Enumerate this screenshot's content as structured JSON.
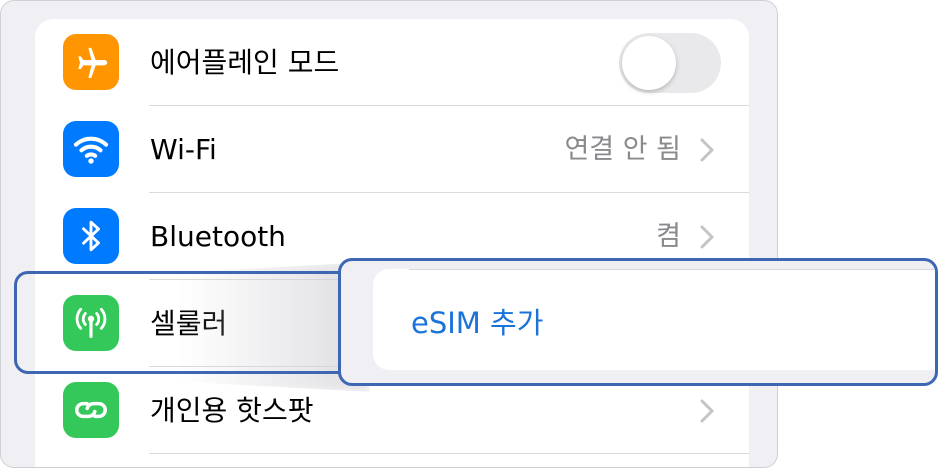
{
  "settings": {
    "rows": [
      {
        "label": "에어플레인 모드",
        "icon": "airplane-icon",
        "icon_color": "#ff9500",
        "control": "toggle",
        "toggle_on": false
      },
      {
        "label": "Wi-Fi",
        "icon": "wifi-icon",
        "icon_color": "#007aff",
        "value": "연결 안 됨",
        "control": "chevron"
      },
      {
        "label": "Bluetooth",
        "icon": "bluetooth-icon",
        "icon_color": "#007aff",
        "value": "켬",
        "control": "chevron"
      },
      {
        "label": "셀룰러",
        "icon": "cellular-antenna-icon",
        "icon_color": "#34c759",
        "control": "none"
      },
      {
        "label": "개인용 핫스팟",
        "icon": "hotspot-link-icon",
        "icon_color": "#34c759",
        "control": "chevron"
      }
    ]
  },
  "popover": {
    "label": "eSIM 추가",
    "label_color": "#1a73d9"
  },
  "highlight_color": "#3e67b3"
}
